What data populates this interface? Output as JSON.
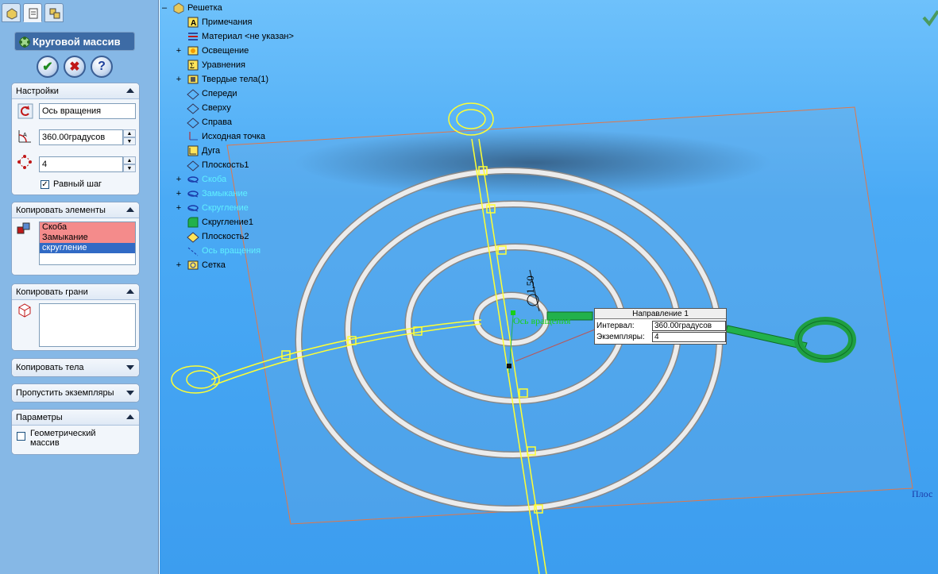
{
  "property_manager": {
    "tabs": [
      "feature-manager-tab",
      "property-manager-tab",
      "configuration-manager-tab"
    ],
    "title": "Круговой массив",
    "actions": {
      "ok": "✔",
      "cancel": "✖",
      "help": "?"
    },
    "settings": {
      "header": "Настройки",
      "axis_value": "Ось вращения",
      "angle_value": "360.00градусов",
      "count_value": "4",
      "equal_spacing_label": "Равный шаг",
      "equal_spacing_checked": true
    },
    "features_to_pattern": {
      "header": "Копировать элементы",
      "items": [
        "Скоба",
        "Замыкание",
        "скругление"
      ],
      "selected_index": 2
    },
    "faces_to_pattern": {
      "header": "Копировать грани"
    },
    "bodies_to_pattern": {
      "header": "Копировать тела"
    },
    "instances_to_skip": {
      "header": "Пропустить экземпляры"
    },
    "options": {
      "header": "Параметры",
      "geometry_pattern_label": "Геометрический массив",
      "geometry_pattern_checked": false
    }
  },
  "feature_tree": {
    "root": "Решетка",
    "items": [
      {
        "label": "Примечания",
        "icon": "annotations-icon",
        "expander": "",
        "faded": false
      },
      {
        "label": "Материал <не указан>",
        "icon": "material-icon",
        "expander": "",
        "faded": false
      },
      {
        "label": "Освещение",
        "icon": "lighting-icon",
        "expander": "+",
        "faded": false
      },
      {
        "label": "Уравнения",
        "icon": "equations-icon",
        "expander": "",
        "faded": false
      },
      {
        "label": "Твердые тела(1)",
        "icon": "solid-bodies-icon",
        "expander": "+",
        "faded": false
      },
      {
        "label": "Спереди",
        "icon": "plane-icon",
        "expander": "",
        "faded": false
      },
      {
        "label": "Сверху",
        "icon": "plane-icon",
        "expander": "",
        "faded": false
      },
      {
        "label": "Справа",
        "icon": "plane-icon",
        "expander": "",
        "faded": false
      },
      {
        "label": "Исходная точка",
        "icon": "origin-icon",
        "expander": "",
        "faded": false
      },
      {
        "label": "Дуга",
        "icon": "arc-feature-icon",
        "expander": "",
        "faded": false
      },
      {
        "label": "Плоскость1",
        "icon": "plane-icon",
        "expander": "",
        "faded": false
      },
      {
        "label": "Скоба",
        "icon": "sweep-icon",
        "expander": "+",
        "faded": true
      },
      {
        "label": "Замыкание",
        "icon": "sweep-icon",
        "expander": "+",
        "faded": true
      },
      {
        "label": "Скругление",
        "icon": "sweep-icon",
        "expander": "+",
        "faded": true
      },
      {
        "label": "Скругление1",
        "icon": "fillet-icon",
        "expander": "",
        "faded": false
      },
      {
        "label": "Плоскость2",
        "icon": "plane-selected-icon",
        "expander": "",
        "faded": false
      },
      {
        "label": "Ось вращения",
        "icon": "axis-icon",
        "expander": "",
        "faded": true
      },
      {
        "label": "Сетка",
        "icon": "pattern-icon",
        "expander": "+",
        "faded": false
      }
    ]
  },
  "viewport": {
    "callout": {
      "header": "Направление 1",
      "interval_label": "Интервал:",
      "interval_value": "360.00градусов",
      "instances_label": "Экземпляры:",
      "instances_value": "4"
    },
    "axis_label": "Ось вращения",
    "dimension_label": "1,50",
    "plane_label": "Плос",
    "colors": {
      "background": "#4aaaf5",
      "ring": "#e4e4e4",
      "plane_edge": "#e0774a",
      "preview": "#ffff33",
      "selected": "#22b14c"
    }
  }
}
